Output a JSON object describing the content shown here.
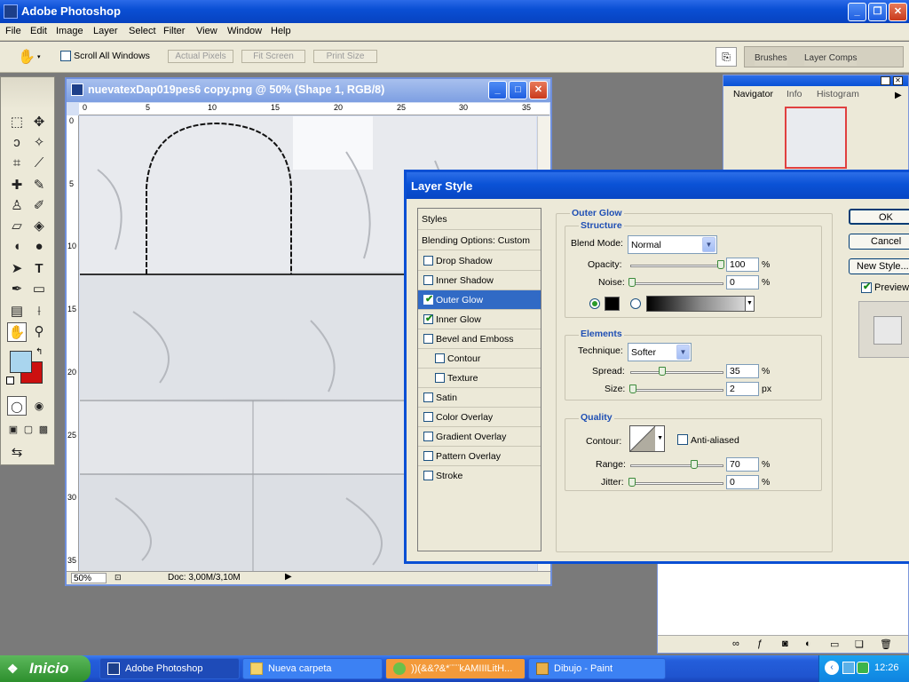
{
  "app": {
    "title": "Adobe Photoshop",
    "menu": [
      "File",
      "Edit",
      "Image",
      "Layer",
      "Select",
      "Filter",
      "View",
      "Window",
      "Help"
    ]
  },
  "options_bar": {
    "scroll_all_label": "Scroll All Windows",
    "buttons": [
      "Actual Pixels",
      "Fit Screen",
      "Print Size"
    ],
    "well_tabs": [
      "Brushes",
      "Layer Comps"
    ]
  },
  "document": {
    "title": "nuevatexDap019pes6 copy.png @ 50% (Shape 1, RGB/8)",
    "ruler_top": [
      "0",
      "5",
      "10",
      "15",
      "20",
      "25",
      "30",
      "35"
    ],
    "ruler_left": [
      "0",
      "5",
      "10",
      "15",
      "20",
      "25",
      "30",
      "35"
    ],
    "zoom": "50%",
    "doc_size": "Doc: 3,00M/3,10M"
  },
  "navigator": {
    "tabs": [
      "Navigator",
      "Info",
      "Histogram"
    ]
  },
  "colors": {
    "foreground": "#a9d5ee",
    "background": "#cc1010",
    "accent": "#0a4fd4"
  },
  "dialog": {
    "title": "Layer Style",
    "styles_header": "Styles",
    "blending_options": "Blending Options: Custom",
    "style_items": [
      {
        "label": "Drop Shadow",
        "checked": false,
        "selected": false,
        "indent": false
      },
      {
        "label": "Inner Shadow",
        "checked": false,
        "selected": false,
        "indent": false
      },
      {
        "label": "Outer Glow",
        "checked": true,
        "selected": true,
        "indent": false
      },
      {
        "label": "Inner Glow",
        "checked": true,
        "selected": false,
        "indent": false
      },
      {
        "label": "Bevel and Emboss",
        "checked": false,
        "selected": false,
        "indent": false
      },
      {
        "label": "Contour",
        "checked": false,
        "selected": false,
        "indent": true
      },
      {
        "label": "Texture",
        "checked": false,
        "selected": false,
        "indent": true
      },
      {
        "label": "Satin",
        "checked": false,
        "selected": false,
        "indent": false
      },
      {
        "label": "Color Overlay",
        "checked": false,
        "selected": false,
        "indent": false
      },
      {
        "label": "Gradient Overlay",
        "checked": false,
        "selected": false,
        "indent": false
      },
      {
        "label": "Pattern Overlay",
        "checked": false,
        "selected": false,
        "indent": false
      },
      {
        "label": "Stroke",
        "checked": false,
        "selected": false,
        "indent": false
      }
    ],
    "section_title": "Outer Glow",
    "structure": {
      "title": "Structure",
      "blend_mode_label": "Blend Mode:",
      "blend_mode_value": "Normal",
      "opacity_label": "Opacity:",
      "opacity_value": "100",
      "noise_label": "Noise:",
      "noise_value": "0",
      "percent": "%"
    },
    "elements": {
      "title": "Elements",
      "technique_label": "Technique:",
      "technique_value": "Softer",
      "spread_label": "Spread:",
      "spread_value": "35",
      "size_label": "Size:",
      "size_value": "2",
      "percent": "%",
      "px": "px"
    },
    "quality": {
      "title": "Quality",
      "contour_label": "Contour:",
      "anti_aliased_label": "Anti-aliased",
      "range_label": "Range:",
      "range_value": "70",
      "jitter_label": "Jitter:",
      "jitter_value": "0",
      "percent": "%"
    },
    "buttons": {
      "ok": "OK",
      "cancel": "Cancel",
      "new_style": "New Style...",
      "preview": "Preview"
    }
  },
  "taskbar": {
    "start": "Inicio",
    "tasks": [
      "Adobe Photoshop",
      "Nueva carpeta",
      "))(&&?&*¨¨¨kAMIIILitH...",
      "Dibujo - Paint"
    ],
    "clock": "12:26"
  }
}
